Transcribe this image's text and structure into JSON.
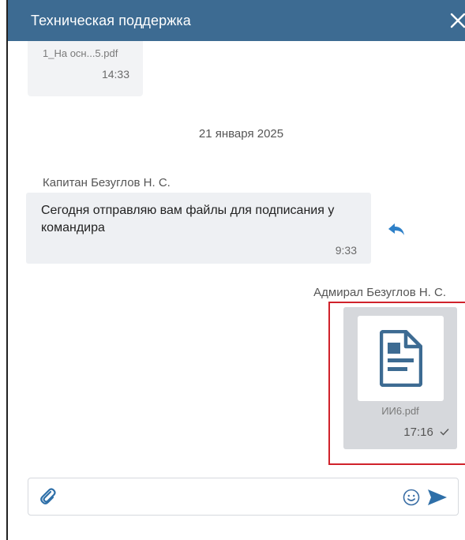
{
  "header": {
    "title": "Техническая поддержка",
    "close_icon": "close-icon"
  },
  "previous_file": {
    "name": "1_На осн...5.pdf",
    "time": "14:33"
  },
  "date_separator": "21 января 2025",
  "incoming_message": {
    "sender": "Капитан Безуглов Н. С.",
    "text": "Сегодня отправляю вам файлы для подписания у командира",
    "time": "9:33",
    "reply_icon": "reply-icon"
  },
  "outgoing_file": {
    "sender": "Адмирал Безуглов Н. С.",
    "file_name": "ИИ6.pdf",
    "time": "17:16",
    "status_icon": "check-icon",
    "file_icon": "document-icon"
  },
  "composer": {
    "placeholder": "",
    "attach_icon": "paperclip-icon",
    "emoji_icon": "smiley-icon",
    "send_icon": "send-icon"
  },
  "colors": {
    "header_bg": "#3d6b92",
    "accent_blue": "#3d6b92",
    "highlight_red": "#d0222b",
    "incoming_bg": "#eef0f3",
    "outgoing_file_bg": "#d6d8dc"
  }
}
